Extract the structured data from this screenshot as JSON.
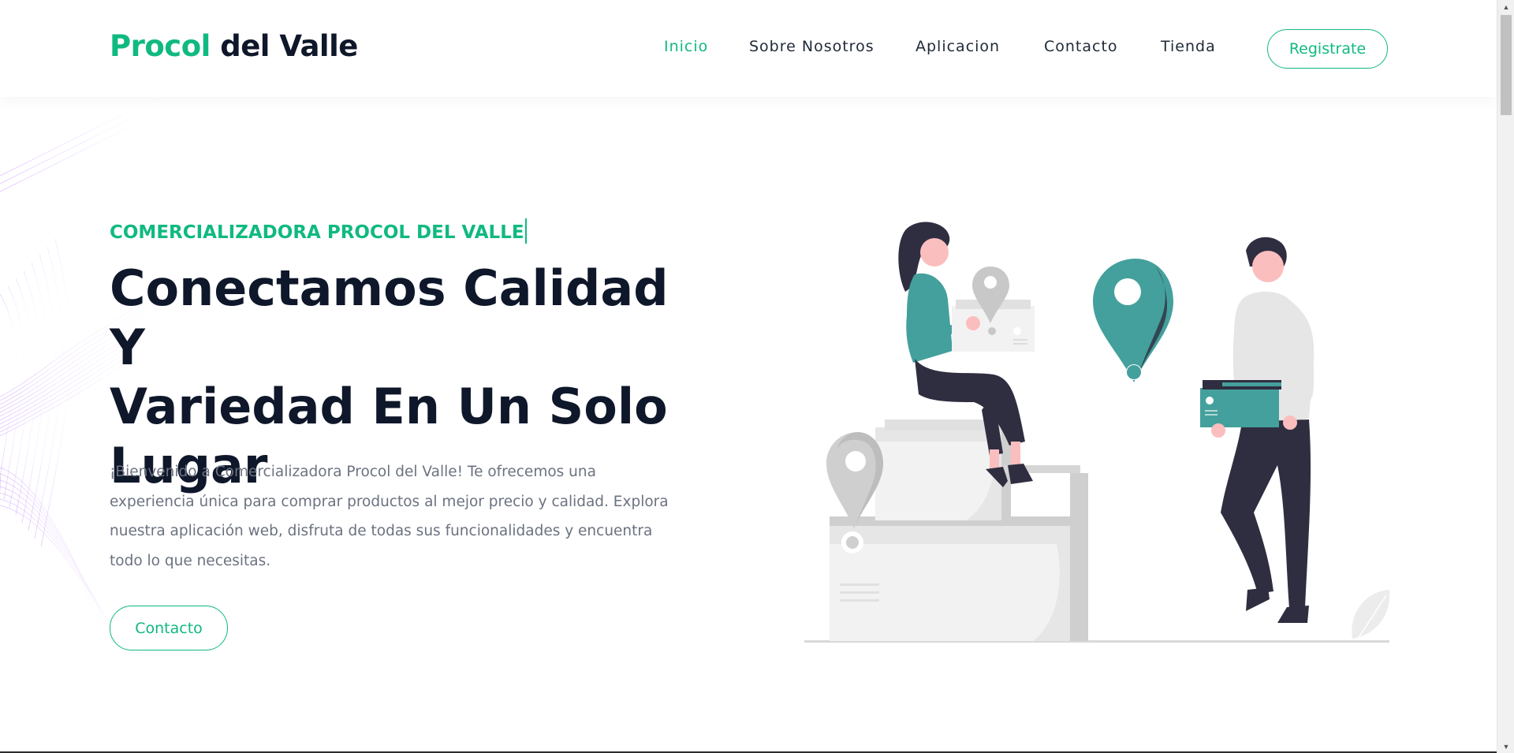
{
  "header": {
    "logo_brand": "Procol",
    "logo_rest": " del Valle",
    "nav": [
      {
        "label": "Inicio",
        "active": true
      },
      {
        "label": "Sobre Nosotros",
        "active": false
      },
      {
        "label": "Aplicacion",
        "active": false
      },
      {
        "label": "Contacto",
        "active": false
      },
      {
        "label": "Tienda",
        "active": false
      }
    ],
    "register_label": "Registrate"
  },
  "hero": {
    "eyebrow": "COMERCIALIZADORA PROCOL DEL VALLE",
    "headline_line1": "Conectamos Calidad Y",
    "headline_line2": "Variedad En Un Solo",
    "headline_line3": "Lugar",
    "description": "¡Bienvenido a Comercializadora Procol del Valle! Te ofrecemos una experiencia única para comprar productos al mejor precio y calidad. Explora nuestra aplicación web, disfruta de todas sus funcionalidades y encuentra todo lo que necesitas.",
    "contact_label": "Contacto"
  },
  "colors": {
    "accent": "#10b981",
    "heading": "#0f172a",
    "body_text": "#6b7280",
    "illustration_teal": "#44a09c",
    "illustration_dark": "#2f2e41"
  },
  "icons": {
    "location_pin": "location-pin-icon",
    "scroll_up": "scroll-up-arrow-icon",
    "scroll_down": "scroll-down-arrow-icon"
  }
}
